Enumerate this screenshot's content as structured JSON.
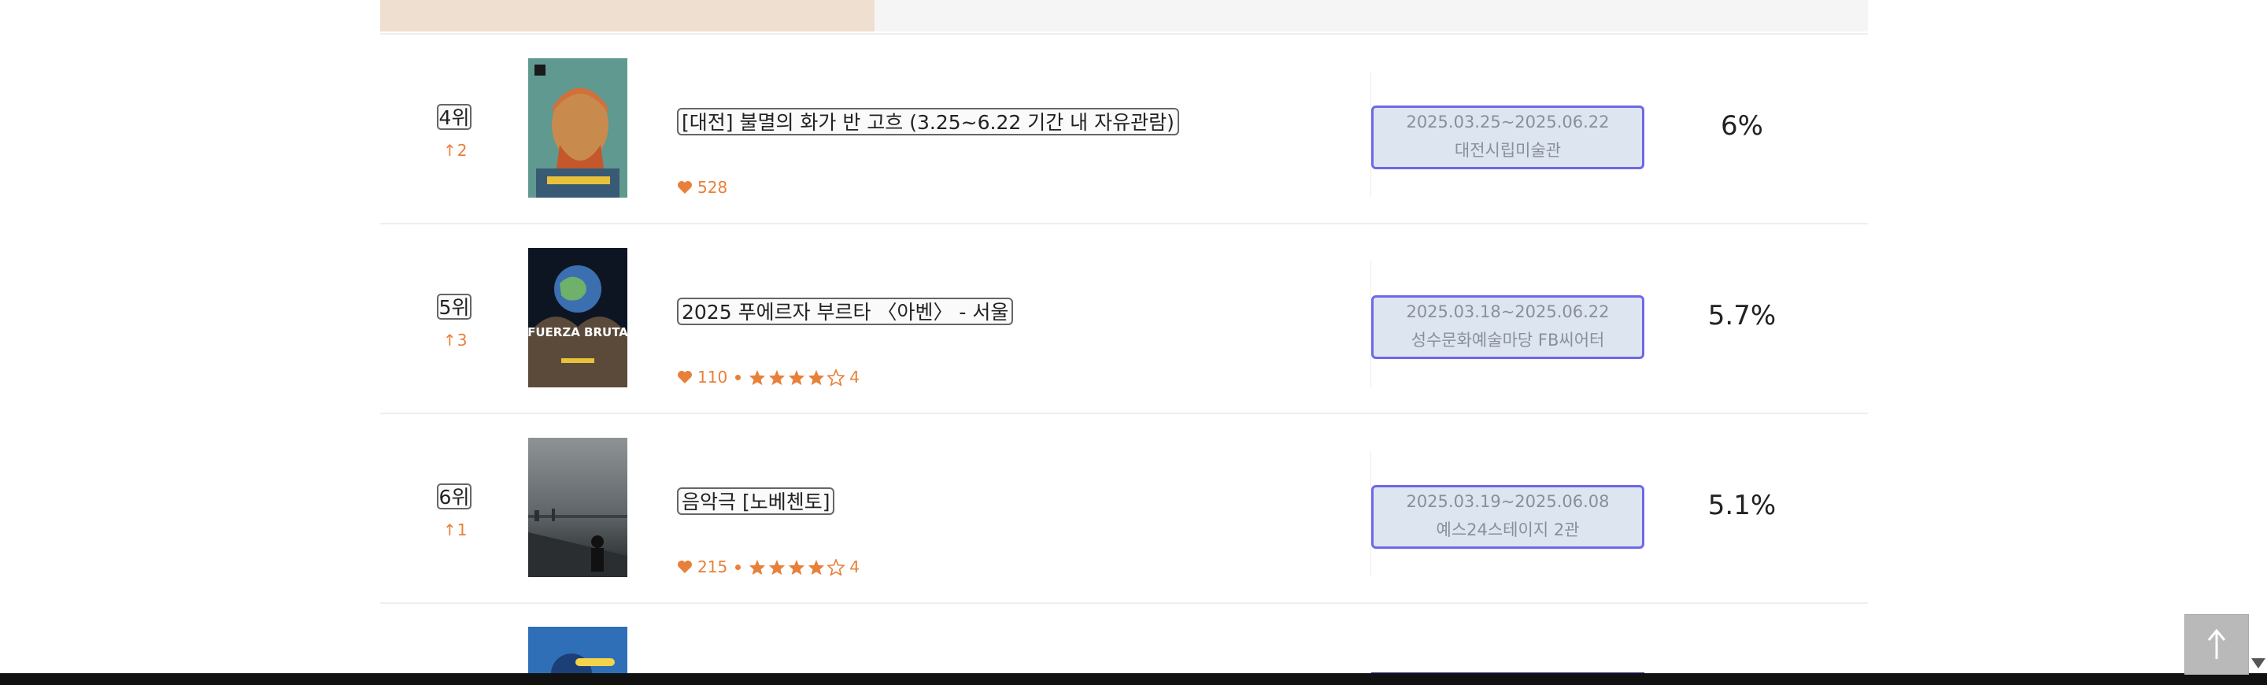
{
  "accent_color": "#e8803a",
  "date_border_color": "#6f68e6",
  "rankings": [
    {
      "rank": "4위",
      "change": "↑2",
      "title": "[대전] 불멸의 화가 반 고흐 (3.25~6.22 기간 내 자유관람)",
      "likes": "528",
      "rating": null,
      "dates": "2025.03.25~2025.06.22",
      "venue": "대전시립미술관",
      "share": "6%"
    },
    {
      "rank": "5위",
      "change": "↑3",
      "title": "2025 푸에르자 부르타 〈아벤〉 - 서울",
      "likes": "110",
      "rating": "4",
      "dates": "2025.03.18~2025.06.22",
      "venue": "성수문화예술마당 FB씨어터",
      "share": "5.7%",
      "poster_text": "FUERZA BRUTA"
    },
    {
      "rank": "6위",
      "change": "↑1",
      "title": "음악극 [노베첸토]",
      "likes": "215",
      "rating": "4",
      "dates": "2025.03.19~2025.06.08",
      "venue": "예스24스테이지 2관",
      "share": "5.1%"
    }
  ],
  "icons": {
    "like": "heart-icon",
    "star_filled": "star-filled-icon",
    "star_empty": "star-empty-icon",
    "back_to_top": "arrow-up-icon"
  }
}
